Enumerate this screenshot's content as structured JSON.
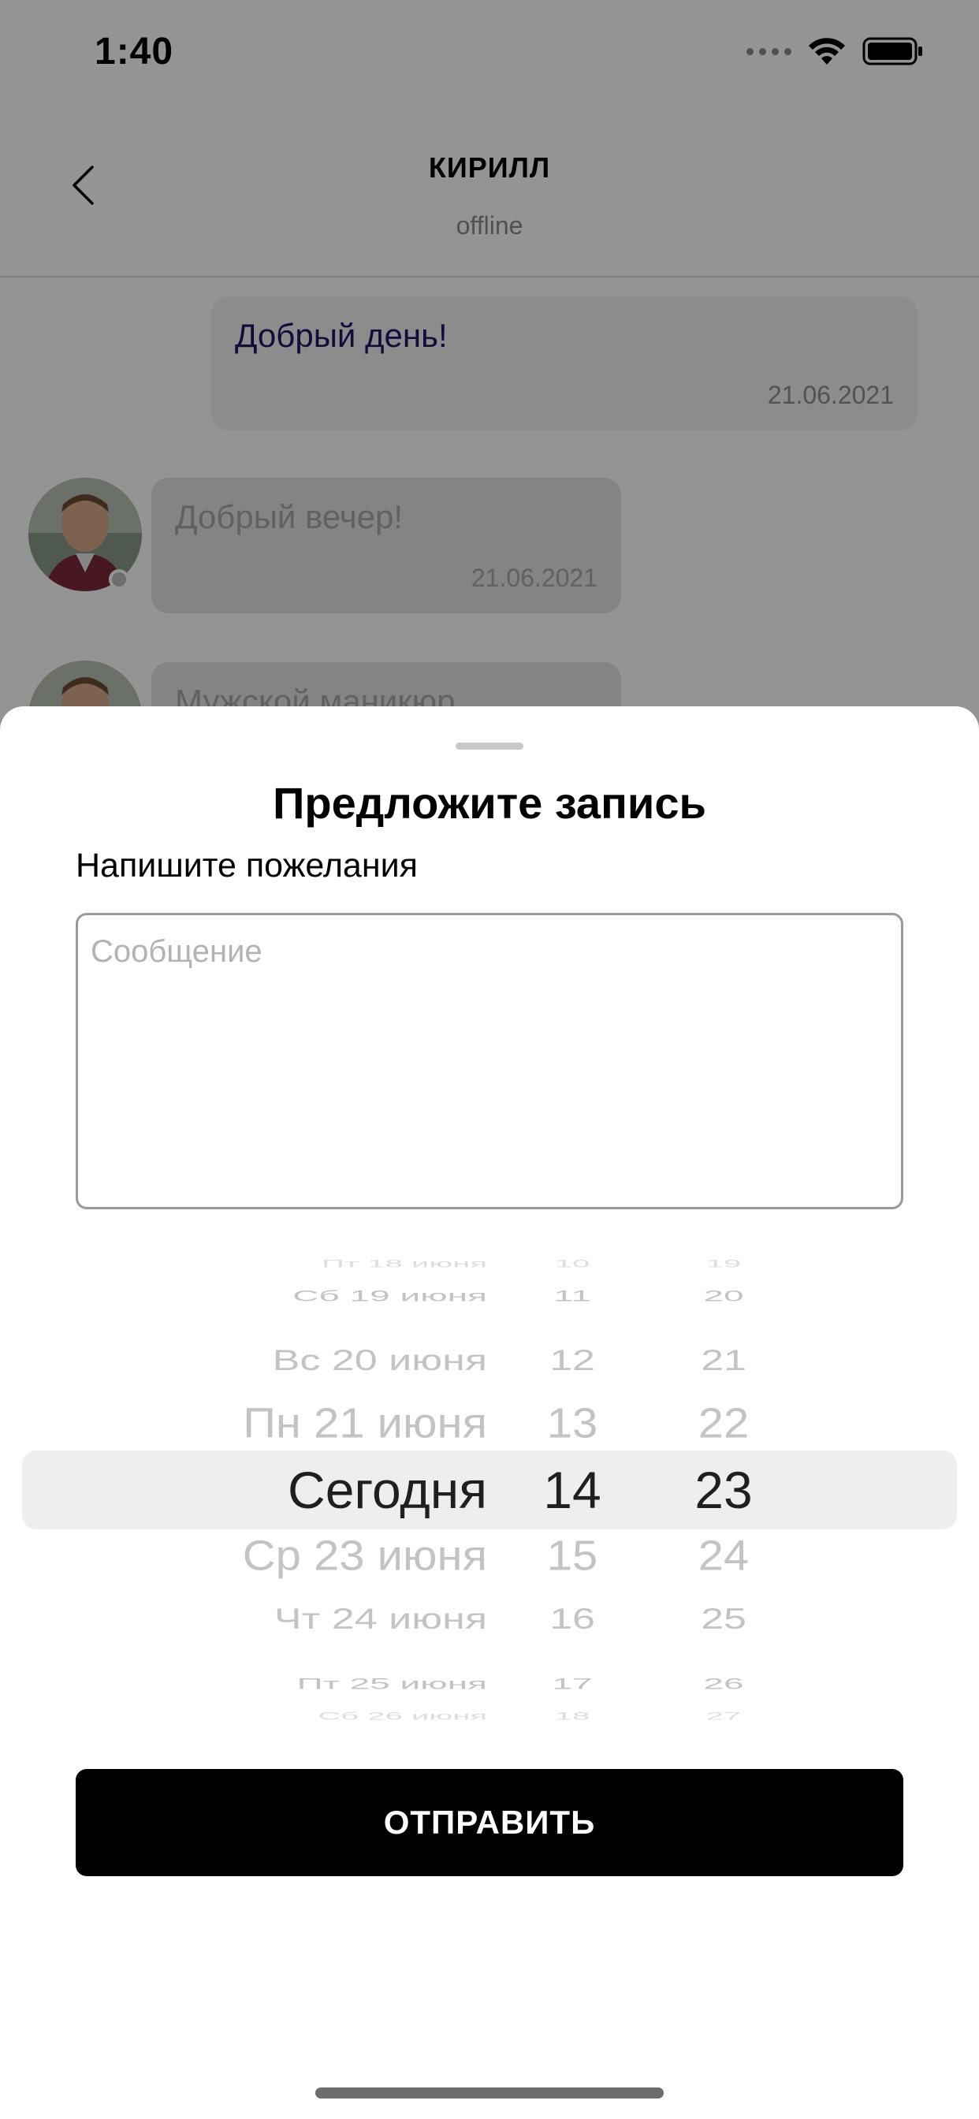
{
  "status_bar": {
    "time": "1:40"
  },
  "chat_header": {
    "name": "КИРИЛЛ",
    "status": "offline"
  },
  "messages": [
    {
      "text": "Добрый день!",
      "date": "21.06.2021"
    },
    {
      "text": "Добрый вечер!",
      "date": "21.06.2021"
    },
    {
      "text": "Мужской маникюр"
    }
  ],
  "sheet": {
    "title": "Предложите запись",
    "subtitle": "Напишите пожелания",
    "message_placeholder": "Сообщение",
    "send_label": "ОТПРАВИТЬ"
  },
  "picker": {
    "rows": [
      {
        "date": "Пт 18 июня",
        "hour": "10",
        "minute": "19"
      },
      {
        "date": "Сб 19 июня",
        "hour": "11",
        "minute": "20"
      },
      {
        "date": "Вс 20 июня",
        "hour": "12",
        "minute": "21"
      },
      {
        "date": "Пн 21 июня",
        "hour": "13",
        "minute": "22"
      },
      {
        "date": "Сегодня",
        "hour": "14",
        "minute": "23"
      },
      {
        "date": "Ср 23 июня",
        "hour": "15",
        "minute": "24"
      },
      {
        "date": "Чт 24 июня",
        "hour": "16",
        "minute": "25"
      },
      {
        "date": "Пт 25 июня",
        "hour": "17",
        "minute": "26"
      },
      {
        "date": "Сб 26 июня",
        "hour": "18",
        "minute": "27"
      }
    ],
    "selected_index": 4
  },
  "colors": {
    "accent": "#000000",
    "outgoing_text": "#1c1866",
    "placeholder": "#b3b3b3"
  }
}
